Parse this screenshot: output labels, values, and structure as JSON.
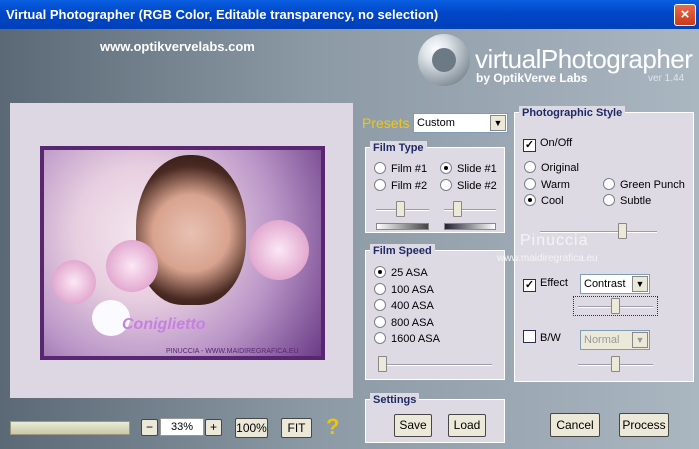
{
  "window": {
    "title": "Virtual Photographer (RGB Color, Editable transparency, no selection)",
    "close_label": "×"
  },
  "header": {
    "website": "www.optikvervelabs.com",
    "brand": "virtualPhotographer",
    "byline": "by OptikVerve Labs",
    "version": "ver 1.44"
  },
  "preview": {
    "signature": "Coniglietto",
    "credit": "PINUCCIA - WWW.MAIDIREGRAFICA.EU"
  },
  "presets": {
    "label": "Presets",
    "selected": "Custom"
  },
  "film_type": {
    "label": "Film Type",
    "options": [
      "Film #1",
      "Slide #1",
      "Film #2",
      "Slide #2"
    ],
    "selected": "Slide #1",
    "slider1": 0.45,
    "slider2": 0.2
  },
  "film_speed": {
    "label": "Film Speed",
    "options": [
      "25 ASA",
      "100 ASA",
      "400 ASA",
      "800 ASA",
      "1600 ASA"
    ],
    "selected": "25 ASA",
    "slider": 0.0
  },
  "settings": {
    "label": "Settings",
    "save": "Save",
    "load": "Load"
  },
  "photo_style": {
    "label": "Photographic Style",
    "onoff": "On/Off",
    "onoff_checked": true,
    "options": [
      "Original",
      "Warm",
      "Green Punch",
      "Cool",
      "Subtle"
    ],
    "selected": "Cool",
    "slider": 0.72,
    "effect_label": "Effect",
    "effect_checked": true,
    "effect_value": "Contrast",
    "effect_slider": 0.5,
    "bw_label": "B/W",
    "bw_checked": false,
    "bw_value": "Normal",
    "bw_slider": 0.5
  },
  "zoom": {
    "minus": "−",
    "value": "33%",
    "plus": "+",
    "full": "100%",
    "fit": "FIT"
  },
  "help": "?",
  "actions": {
    "cancel": "Cancel",
    "process": "Process"
  },
  "watermark": {
    "name": "Pinuccia",
    "url": "www.maidiregrafica.eu"
  }
}
